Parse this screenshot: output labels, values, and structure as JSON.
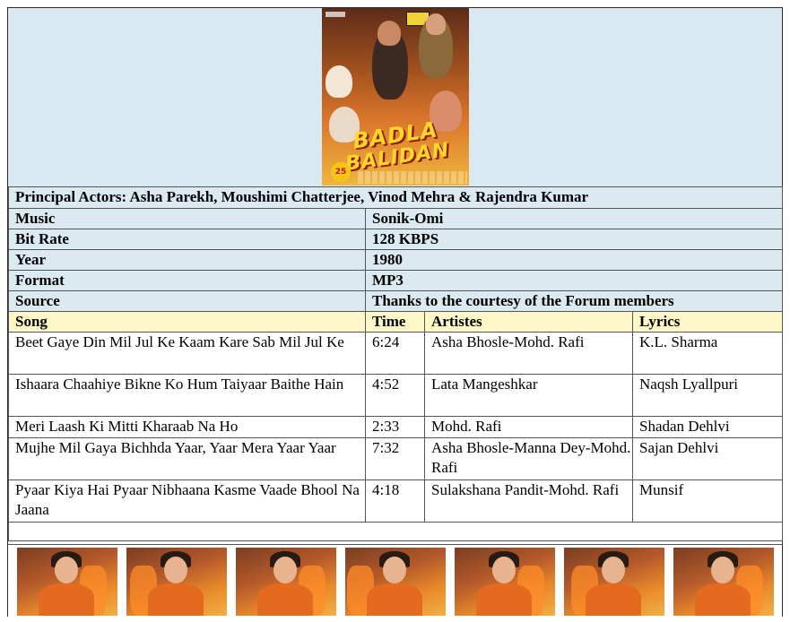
{
  "poster": {
    "title_line1": "BADLA",
    "title_line2": "BALIDAN",
    "badge": "25"
  },
  "actors_row": "Principal  Actors: Asha Parekh, Moushimi  Chatterjee, Vinod  Mehra & Rajendra Kumar",
  "details": [
    {
      "label": "Music",
      "value": "Sonik-Omi"
    },
    {
      "label": "Bit Rate",
      "value": "128 KBPS"
    },
    {
      "label": "Year",
      "value": "1980"
    },
    {
      "label": "Format",
      "value": "MP3"
    },
    {
      "label": "Source",
      "value": "Thanks to the courtesy of the Forum  members"
    }
  ],
  "songs_header": {
    "song": "Song",
    "time": "Time",
    "artistes": "Artistes",
    "lyrics": "Lyrics"
  },
  "songs": [
    {
      "song": "Beet Gaye Din Mil Jul Ke Kaam Kare Sab Mil Jul Ke",
      "time": "6:24",
      "artistes": "Asha Bhosle-Mohd. Rafi",
      "lyrics": "K.L. Sharma"
    },
    {
      "song": "Ishaara Chaahiye Bikne Ko Hum Taiyaar Baithe Hain",
      "time": "4:52",
      "artistes": "Lata Mangeshkar",
      "lyrics": "Naqsh Lyallpuri"
    },
    {
      "song": "Meri Laash Ki Mitti Kharaab Na Ho",
      "time": "2:33",
      "artistes": "Mohd. Rafi",
      "lyrics": "Shadan Dehlvi"
    },
    {
      "song": "Mujhe Mil Gaya Bichhda Yaar, Yaar Mera Yaar Yaar",
      "time": "7:32",
      "artistes": "Asha Bhosle-Manna Dey-Mohd. Rafi",
      "lyrics": "Sajan Dehlvi"
    },
    {
      "song": "Pyaar Kiya Hai Pyaar Nibhaana Kasme Vaade Bhool Na Jaana",
      "time": "4:18",
      "artistes": "Sulakshana Pandit-Mohd. Rafi",
      "lyrics": "Munsif"
    }
  ],
  "colors": {
    "header_blue": "#dbe9f1",
    "header_yellow": "#fdf7c7",
    "border": "#555555"
  }
}
